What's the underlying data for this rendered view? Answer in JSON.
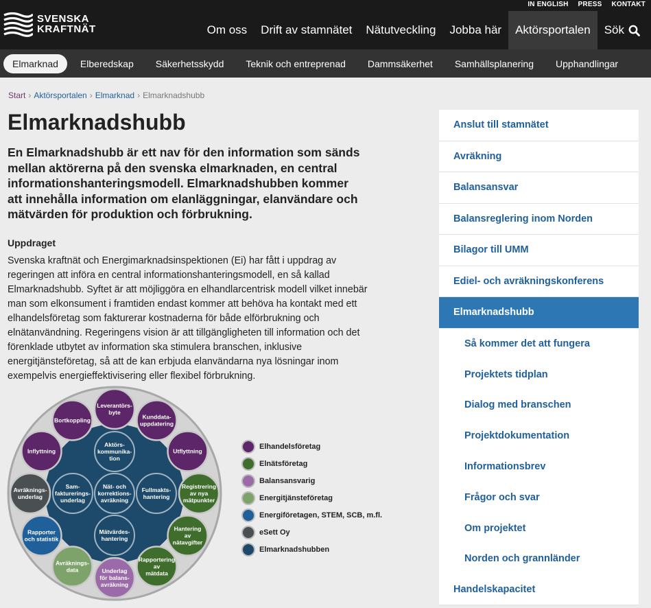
{
  "header": {
    "logo_line1": "SVENSKA",
    "logo_line2": "KRAFTNÄT",
    "util_links": [
      "IN ENGLISH",
      "PRESS",
      "KONTAKT"
    ],
    "nav": [
      "Om oss",
      "Drift av stamnätet",
      "Nätutveckling",
      "Jobba här",
      "Aktörsportalen"
    ],
    "search_label": "Sök"
  },
  "subnav": [
    "Elmarknad",
    "Elberedskap",
    "Säkerhetsskydd",
    "Teknik och entreprenad",
    "Dammsäkerhet",
    "Samhällsplanering",
    "Upphandlingar"
  ],
  "breadcrumb": [
    "Start",
    "Aktörsportalen",
    "Elmarknad",
    "Elmarknadshubb"
  ],
  "page": {
    "title": "Elmarknadshubb",
    "lead": "En Elmarknadshubb är ett nav för den information som sänds mellan aktörerna på den svenska elmarknaden, en central informationshanteringsmodell. Elmarknadshubben kommer att innehålla information om elanläggningar, elanvändare och mätvärden för produktion och förbrukning.",
    "section_heading": "Uppdraget",
    "body": "Svenska kraftnät och Energimarknadsinspektionen (Ei) har fått i uppdrag av regeringen att införa en central informationshanteringsmodell, en så kallad Elmarknadshubb. Syftet är att möjliggöra en elhandlarcentrisk modell vilket innebär man som elkonsument i framtiden endast kommer att behöva ha kontakt med ett elhandelsföretag som fakturerar kostnaderna för både elförbrukning och elnätanvändning. Regeringens vision är att tillgängligheten till information och det förenklade utbytet av information ska stimulera branschen, inklusive energitjänsteföretag, så att de kan erbjuda elanvändarna nya lösningar inom exempelvis energieffektivisering eller flexibel förbrukning."
  },
  "diagram": {
    "outer": [
      {
        "label": "Leverantörs-\nbyte",
        "color": "#5c2668"
      },
      {
        "label": "Kunddata-\nuppdatering",
        "color": "#5c2668"
      },
      {
        "label": "Utflyttning",
        "color": "#5c2668"
      },
      {
        "label": "Registrering\nav nya\nmätpunkter",
        "color": "#3f6e2c"
      },
      {
        "label": "Hantering\nav\nnätavgifter",
        "color": "#3f6e2c"
      },
      {
        "label": "Rapportering\nav\nmätdata",
        "color": "#3f6e2c"
      },
      {
        "label": "Underlag\nför balans-\navräkning",
        "color": "#9b6aa8"
      },
      {
        "label": "Avräknings-\ndata",
        "color": "#7ea36a"
      },
      {
        "label": "Rapporter\noch statistik",
        "color": "#1f5f9a"
      },
      {
        "label": "Avräknings-\nunderlag",
        "color": "#4a4f52"
      },
      {
        "label": "Inflyttning",
        "color": "#5c2668"
      },
      {
        "label": "Bortkoppling",
        "color": "#5c2668"
      }
    ],
    "inner": [
      {
        "label": "Aktörs-\nkommunika-\ntion"
      },
      {
        "label": "Sam-\nfakturerings-\nunderlag"
      },
      {
        "label": "Nät- och\nkorrektions-\navräkning"
      },
      {
        "label": "Fullmakts-\nhantering"
      },
      {
        "label": "Mätvärdes-\nhantering"
      }
    ],
    "colors": {
      "hub": "#1d4a6b",
      "ring": "#d4d4d4",
      "inner_stroke": "#9fb3c2"
    }
  },
  "legend": [
    {
      "label": "Elhandelsföretag",
      "color": "#5c2668"
    },
    {
      "label": "Elnätsföretag",
      "color": "#3f6e2c"
    },
    {
      "label": "Balansansvarig",
      "color": "#9b6aa8"
    },
    {
      "label": "Energitjänsteföretag",
      "color": "#7ea36a"
    },
    {
      "label": "Energiföretagen, STEM, SCB, m.fl.",
      "color": "#1f5f9a"
    },
    {
      "label": "eSett Oy",
      "color": "#4a4f52"
    },
    {
      "label": "Elmarknadshubben",
      "color": "#1d4a6b"
    }
  ],
  "sidebar": [
    {
      "label": "Anslut till stamnätet"
    },
    {
      "label": "Avräkning"
    },
    {
      "label": "Balansansvar"
    },
    {
      "label": "Balansreglering inom Norden"
    },
    {
      "label": "Bilagor till UMM"
    },
    {
      "label": "Ediel- och avräkningskonferens"
    },
    {
      "label": "Elmarknadshubb",
      "active": true
    },
    {
      "label": "Så kommer det att fungera",
      "sub": true
    },
    {
      "label": "Projektets tidplan",
      "sub": true
    },
    {
      "label": "Dialog med branschen",
      "sub": true
    },
    {
      "label": "Projektdokumentation",
      "sub": true
    },
    {
      "label": "Informationsbrev",
      "sub": true
    },
    {
      "label": "Frågor och svar",
      "sub": true
    },
    {
      "label": "Om projektet",
      "sub": true
    },
    {
      "label": "Norden och grannländer",
      "sub": true
    },
    {
      "label": "Handelskapacitet"
    }
  ]
}
